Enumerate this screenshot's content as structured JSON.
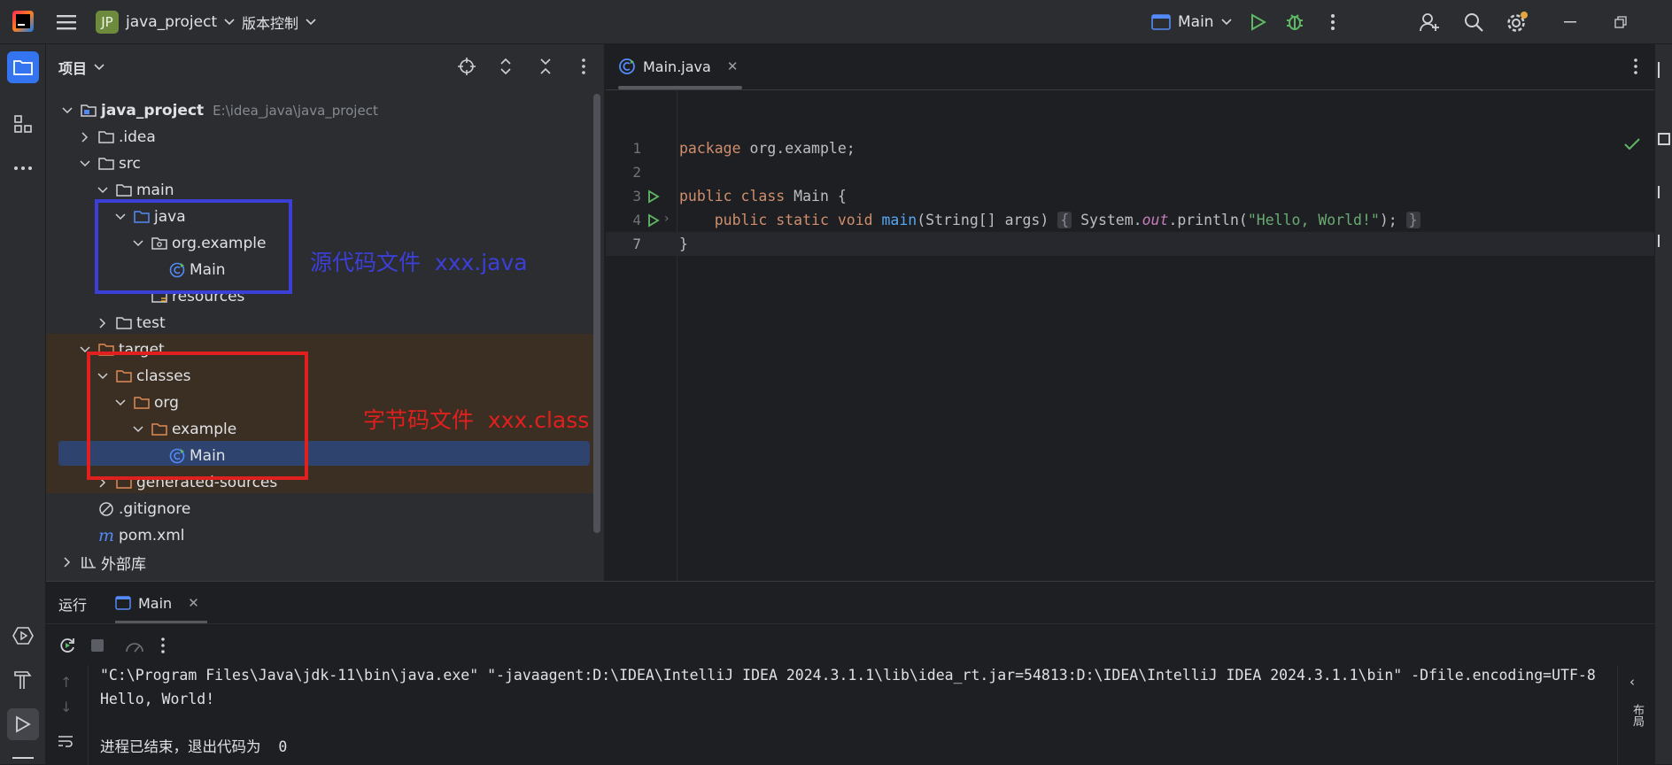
{
  "titlebar": {
    "project_badge": "JP",
    "project_name": "java_project",
    "vcs_label": "版本控制",
    "run_config": "Main"
  },
  "project_panel": {
    "title": "项目",
    "tree": [
      {
        "label": "java_project",
        "path": "E:\\idea_java\\java_project"
      },
      {
        "label": ".idea"
      },
      {
        "label": "src"
      },
      {
        "label": "main"
      },
      {
        "label": "java"
      },
      {
        "label": "org.example"
      },
      {
        "label": "Main"
      },
      {
        "label": "resources"
      },
      {
        "label": "test"
      },
      {
        "label": "target"
      },
      {
        "label": "classes"
      },
      {
        "label": "org"
      },
      {
        "label": "example"
      },
      {
        "label": "Main"
      },
      {
        "label": "generated-sources"
      },
      {
        "label": ".gitignore"
      },
      {
        "label": "pom.xml"
      },
      {
        "label": "外部库"
      }
    ]
  },
  "annotations": {
    "source_note": "源代码文件  xxx.java",
    "source_color": "#3c3fd6",
    "bytecode_note": "字节码文件  xxx.class",
    "bytecode_color": "#e0201e"
  },
  "editor": {
    "tab_label": "Main.java",
    "line_numbers": [
      "1",
      "2",
      "3",
      "4",
      "7"
    ],
    "code": {
      "l1_kw": "package",
      "l1_rest": " org.example;",
      "l3_kw": "public class",
      "l3_rest": " Main {",
      "l4_kw": "public static void",
      "l4_fn": "main",
      "l4_args": "(String[] args) ",
      "l4_fold_open": "{",
      "l4_sys": " System.",
      "l4_out": "out",
      "l4_print": ".println(",
      "l4_str": "\"Hello, World!\"",
      "l4_end": "); ",
      "l4_fold_close": "}",
      "l7": "}"
    }
  },
  "run_panel": {
    "title": "运行",
    "tab_label": "Main",
    "console": [
      "\"C:\\Program Files\\Java\\jdk-11\\bin\\java.exe\" \"-javaagent:D:\\IDEA\\IntelliJ IDEA 2024.3.1.1\\lib\\idea_rt.jar=54813:D:\\IDEA\\IntelliJ IDEA 2024.3.1.1\\bin\" -Dfile.encoding=UTF-8",
      "Hello, World!",
      "",
      "进程已结束，退出代码为  0"
    ],
    "right_label": "布局"
  },
  "colors": {
    "accent": "#3574f0",
    "run_green": "#5fb865",
    "target_bg": "#3a2f22",
    "selection_bg": "#2e436e"
  }
}
